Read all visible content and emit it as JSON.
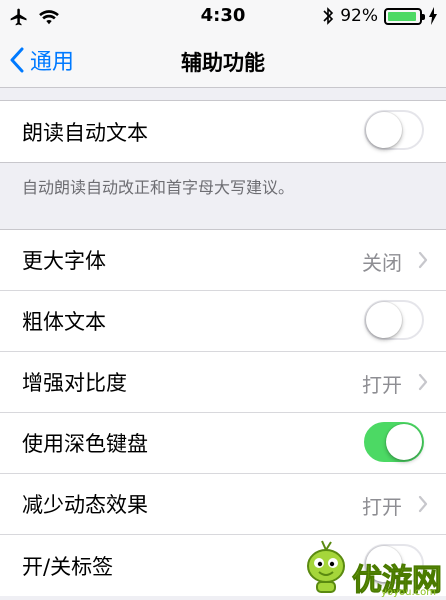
{
  "status_bar": {
    "time": "4:30",
    "battery_text": "92%",
    "battery_level": 0.92,
    "icons": [
      "airplane-icon",
      "wifi-icon",
      "bluetooth-icon",
      "battery-icon",
      "charging-icon"
    ]
  },
  "nav": {
    "back_label": "通用",
    "title": "辅助功能"
  },
  "group1": {
    "rows": [
      {
        "label": "朗读自动文本",
        "toggle": false
      }
    ],
    "footnote": "自动朗读自动改正和首字母大写建议。"
  },
  "group2": {
    "rows": [
      {
        "label": "更大字体",
        "value": "关闭",
        "type": "disclosure"
      },
      {
        "label": "粗体文本",
        "type": "toggle",
        "toggle": false
      },
      {
        "label": "增强对比度",
        "value": "打开",
        "type": "disclosure"
      },
      {
        "label": "使用深色键盘",
        "type": "toggle",
        "toggle": true
      },
      {
        "label": "减少动态效果",
        "value": "打开",
        "type": "disclosure"
      },
      {
        "label": "开/关标签",
        "type": "toggle",
        "toggle": false
      }
    ]
  },
  "colors": {
    "accent": "#007aff",
    "toggle_on": "#4cd964",
    "background": "#efeff4"
  },
  "watermark": {
    "brand": "优游网",
    "url": "yoyou.com"
  }
}
